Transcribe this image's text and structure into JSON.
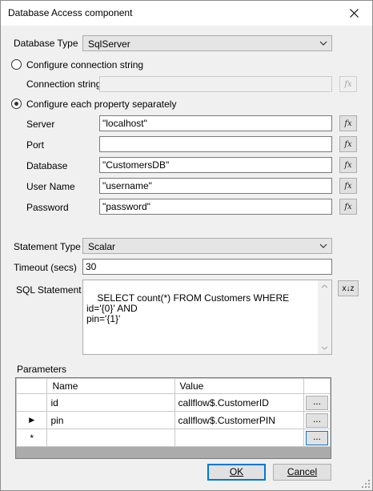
{
  "window": {
    "title": "Database Access component"
  },
  "database_type": {
    "label": "Database Type",
    "value": "SqlServer"
  },
  "connection_string_option": {
    "label": "Configure connection string",
    "checked": false
  },
  "connection_string": {
    "label": "Connection string",
    "value": ""
  },
  "separate_properties_option": {
    "label": "Configure each property separately",
    "checked": true
  },
  "properties": [
    {
      "label": "Server",
      "value": "\"localhost\""
    },
    {
      "label": "Port",
      "value": ""
    },
    {
      "label": "Database",
      "value": "\"CustomersDB\""
    },
    {
      "label": "User Name",
      "value": "\"username\""
    },
    {
      "label": "Password",
      "value": "\"password\""
    }
  ],
  "fx_button": {
    "label": "fx"
  },
  "statement_type": {
    "label": "Statement Type",
    "value": "Scalar"
  },
  "timeout": {
    "label": "Timeout (secs)",
    "value": "30"
  },
  "sql_statement": {
    "label": "SQL Statement",
    "value": "SELECT count(*) FROM Customers WHERE id='{0}' AND\npin='{1}'",
    "xyz_button": "x↓z"
  },
  "parameters": {
    "label": "Parameters",
    "columns": [
      "Name",
      "Value"
    ],
    "rows": [
      {
        "marker": "",
        "name": "id",
        "value": "callflow$.CustomerID",
        "button": "..."
      },
      {
        "marker": "▶",
        "name": "pin",
        "value": "callflow$.CustomerPIN",
        "button": "..."
      },
      {
        "marker": "*",
        "name": "",
        "value": "",
        "button": "..."
      }
    ]
  },
  "buttons": {
    "ok": "OK",
    "cancel": "Cancel"
  },
  "colors": {
    "accent": "#0078d7",
    "dialog_bg": "#f0f0f0"
  }
}
